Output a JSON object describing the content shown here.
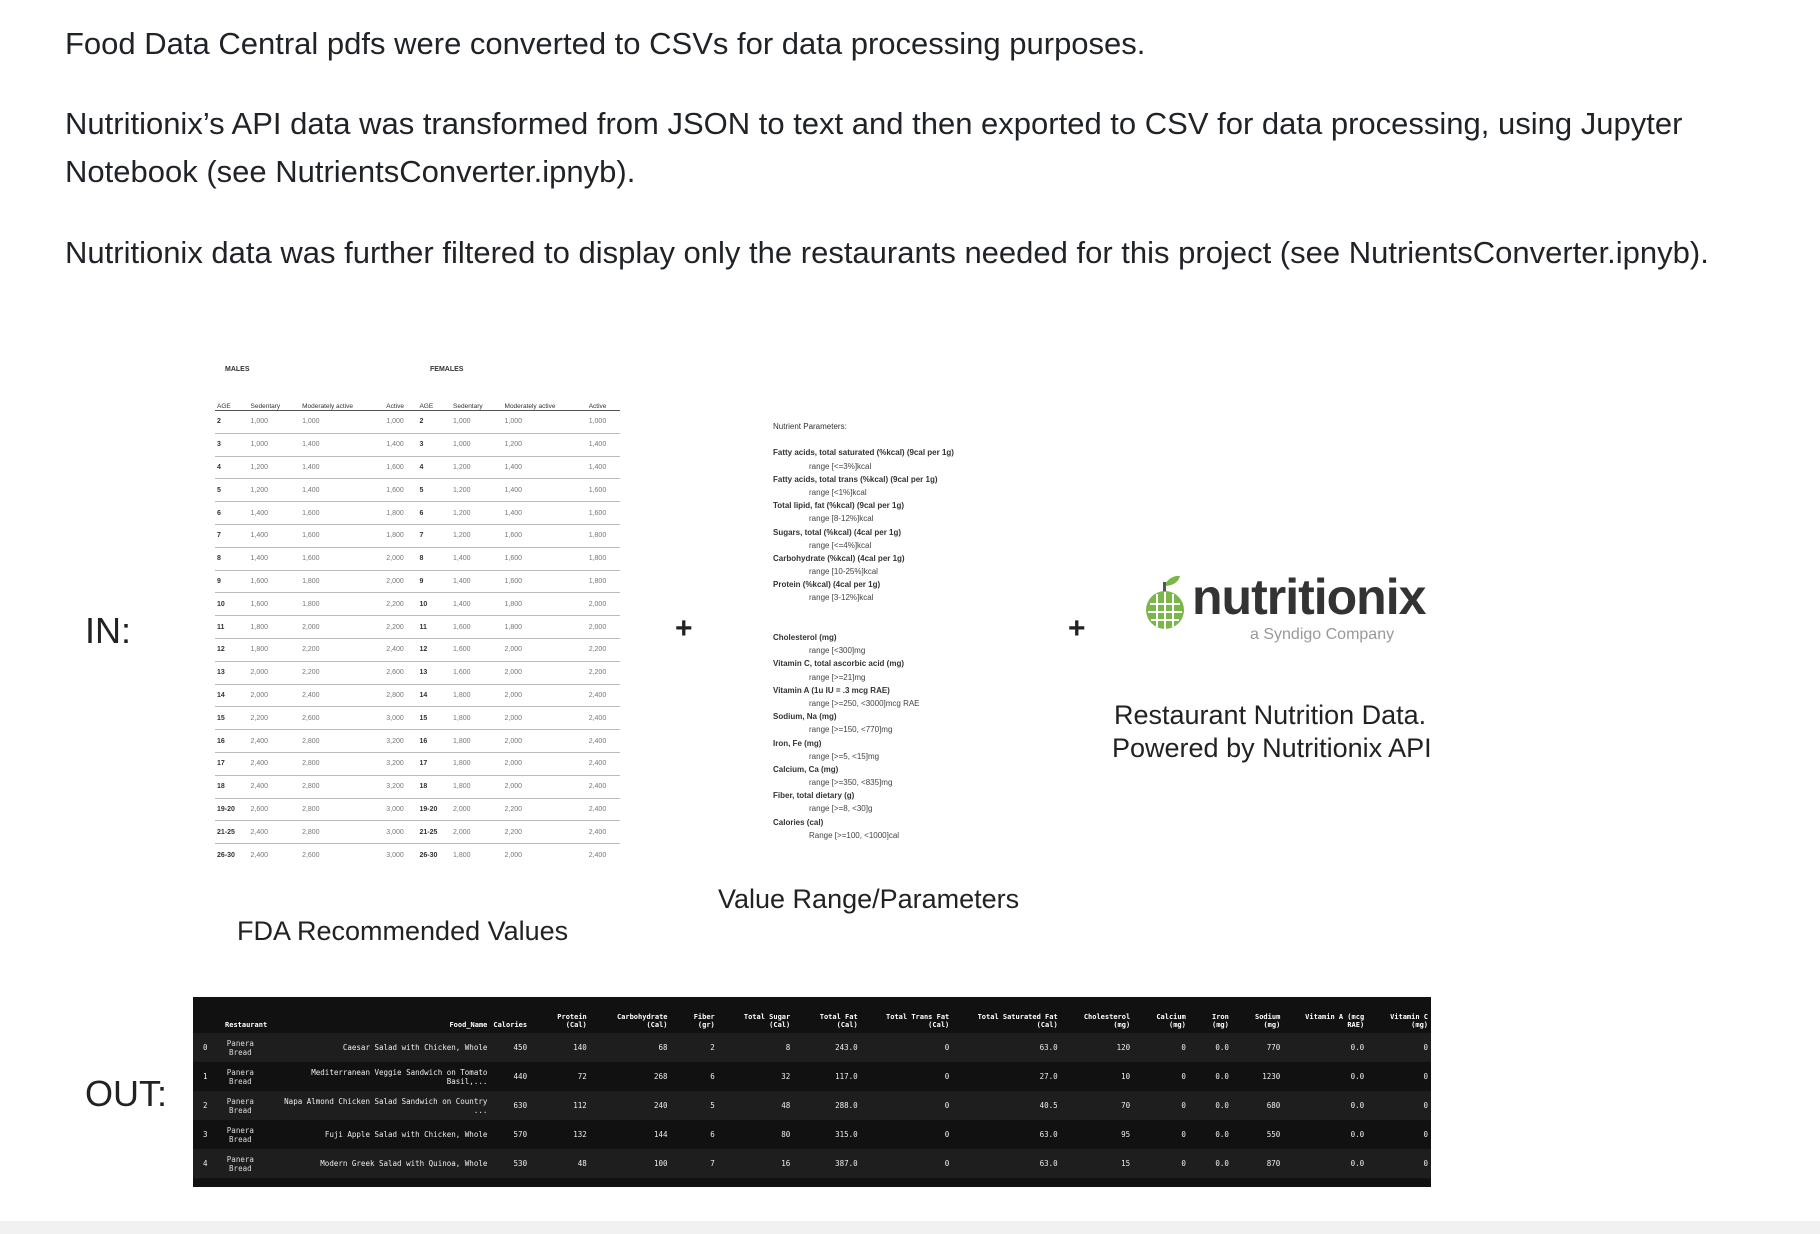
{
  "paragraphs": {
    "p1": "Food Data Central pdfs were converted to CSVs for data processing purposes.",
    "p2": "Nutritionix’s API data was transformed from JSON to text and then exported to CSV for data processing, using Jupyter Notebook (see NutrientsConverter.ipnyb).",
    "p3": "Nutritionix data was further filtered to display only the restaurants needed for this project (see NutrientsConverter.ipnyb)."
  },
  "figure": {
    "in_label": "IN:",
    "out_label": "OUT:",
    "plus1": "+",
    "plus2": "+",
    "fda_caption": "FDA Recommended Values",
    "params_caption": "Value Range/Parameters",
    "nutritionix_caption_line1": "Restaurant Nutrition Data.",
    "nutritionix_caption_line2": "Powered by Nutritionix API",
    "logo_word": "nutritionix",
    "logo_sub": "a Syndigo Company"
  },
  "fda_table": {
    "males_label": "MALES",
    "females_label": "FEMALES",
    "headers": [
      "AGE",
      "Sedentary",
      "Moderately active",
      "Active",
      "AGE",
      "Sedentary",
      "Moderately active",
      "Active"
    ],
    "rows": [
      [
        "2",
        "1,000",
        "1,000",
        "1,000",
        "2",
        "1,000",
        "1,000",
        "1,000"
      ],
      [
        "3",
        "1,000",
        "1,400",
        "1,400",
        "3",
        "1,000",
        "1,200",
        "1,400"
      ],
      [
        "4",
        "1,200",
        "1,400",
        "1,600",
        "4",
        "1,200",
        "1,400",
        "1,400"
      ],
      [
        "5",
        "1,200",
        "1,400",
        "1,600",
        "5",
        "1,200",
        "1,400",
        "1,600"
      ],
      [
        "6",
        "1,400",
        "1,600",
        "1,800",
        "6",
        "1,200",
        "1,400",
        "1,600"
      ],
      [
        "7",
        "1,400",
        "1,600",
        "1,800",
        "7",
        "1,200",
        "1,600",
        "1,800"
      ],
      [
        "8",
        "1,400",
        "1,600",
        "2,000",
        "8",
        "1,400",
        "1,600",
        "1,800"
      ],
      [
        "9",
        "1,600",
        "1,800",
        "2,000",
        "9",
        "1,400",
        "1,600",
        "1,800"
      ],
      [
        "10",
        "1,600",
        "1,800",
        "2,200",
        "10",
        "1,400",
        "1,800",
        "2,000"
      ],
      [
        "11",
        "1,800",
        "2,000",
        "2,200",
        "11",
        "1,600",
        "1,800",
        "2,000"
      ],
      [
        "12",
        "1,800",
        "2,200",
        "2,400",
        "12",
        "1,600",
        "2,000",
        "2,200"
      ],
      [
        "13",
        "2,000",
        "2,200",
        "2,600",
        "13",
        "1,600",
        "2,000",
        "2,200"
      ],
      [
        "14",
        "2,000",
        "2,400",
        "2,800",
        "14",
        "1,800",
        "2,000",
        "2,400"
      ],
      [
        "15",
        "2,200",
        "2,600",
        "3,000",
        "15",
        "1,800",
        "2,000",
        "2,400"
      ],
      [
        "16",
        "2,400",
        "2,800",
        "3,200",
        "16",
        "1,800",
        "2,000",
        "2,400"
      ],
      [
        "17",
        "2,400",
        "2,800",
        "3,200",
        "17",
        "1,800",
        "2,000",
        "2,400"
      ],
      [
        "18",
        "2,400",
        "2,800",
        "3,200",
        "18",
        "1,800",
        "2,000",
        "2,400"
      ],
      [
        "19-20",
        "2,600",
        "2,800",
        "3,000",
        "19-20",
        "2,000",
        "2,200",
        "2,400"
      ],
      [
        "21-25",
        "2,400",
        "2,800",
        "3,000",
        "21-25",
        "2,000",
        "2,200",
        "2,400"
      ],
      [
        "26-30",
        "2,400",
        "2,600",
        "3,000",
        "26-30",
        "1,800",
        "2,000",
        "2,400"
      ]
    ]
  },
  "params": [
    {
      "t": "Nutrient Parameters:",
      "k": "h"
    },
    {
      "t": "",
      "k": "s"
    },
    {
      "t": "Fatty acids, total saturated (%kcal) (9cal per 1g)",
      "k": "b"
    },
    {
      "t": "range [<=3%]kcal",
      "k": "r"
    },
    {
      "t": "Fatty acids, total trans (%kcal) (9cal per 1g)",
      "k": "b"
    },
    {
      "t": "range [<1%]kcal",
      "k": "r"
    },
    {
      "t": "Total lipid, fat (%kcal) (9cal per 1g)",
      "k": "b"
    },
    {
      "t": "range [8-12%]kcal",
      "k": "r"
    },
    {
      "t": "Sugars, total (%kcal) (4cal per 1g)",
      "k": "b"
    },
    {
      "t": "range [<=4%]kcal",
      "k": "r"
    },
    {
      "t": "Carbohydrate (%kcal) (4cal per 1g)",
      "k": "b"
    },
    {
      "t": "range [10-25%]kcal",
      "k": "r"
    },
    {
      "t": "Protein (%kcal) (4cal per 1g)",
      "k": "b"
    },
    {
      "t": "range [3-12%]kcal",
      "k": "r"
    },
    {
      "t": "",
      "k": "s"
    },
    {
      "t": "",
      "k": "s"
    },
    {
      "t": "Cholesterol (mg)",
      "k": "b"
    },
    {
      "t": "range [<300]mg",
      "k": "r"
    },
    {
      "t": "Vitamin C, total ascorbic acid (mg)",
      "k": "b"
    },
    {
      "t": "range [>=21]mg",
      "k": "r"
    },
    {
      "t": "Vitamin A (1u IU = .3 mcg RAE)",
      "k": "b"
    },
    {
      "t": "range [>=250, <3000]mcg RAE",
      "k": "r"
    },
    {
      "t": "Sodium, Na (mg)",
      "k": "b"
    },
    {
      "t": "range [>=150, <770]mg",
      "k": "r"
    },
    {
      "t": "Iron, Fe (mg)",
      "k": "b"
    },
    {
      "t": "range [>=5, <15]mg",
      "k": "r"
    },
    {
      "t": "Calcium, Ca (mg)",
      "k": "b"
    },
    {
      "t": "range [>=350, <835]mg",
      "k": "r"
    },
    {
      "t": "Fiber, total dietary (g)",
      "k": "b"
    },
    {
      "t": "range [>=8, <30]g",
      "k": "r"
    },
    {
      "t": "Calories (cal)",
      "k": "b"
    },
    {
      "t": "Range [>=100, <1000]cal",
      "k": "r"
    }
  ],
  "out_table": {
    "headers": [
      "",
      "Restaurant",
      "Food_Name",
      "Calories",
      "Protein (Cal)",
      "Carbohydrate (Cal)",
      "Fiber (gr)",
      "Total Sugar (Cal)",
      "Total Fat (Cal)",
      "Total Trans Fat (Cal)",
      "Total Saturated Fat (Cal)",
      "Cholesterol (mg)",
      "Calcium (mg)",
      "Iron (mg)",
      "Sodium (mg)",
      "Vitamin A (mcg RAE)",
      "Vitamin C (mg)"
    ],
    "rows": [
      [
        "0",
        "Panera Bread",
        "Caesar Salad with Chicken, Whole",
        "450",
        "140",
        "68",
        "2",
        "8",
        "243.0",
        "0",
        "63.0",
        "120",
        "0",
        "0.0",
        "770",
        "0.0",
        "0"
      ],
      [
        "1",
        "Panera Bread",
        "Mediterranean Veggie Sandwich on Tomato Basil,...",
        "440",
        "72",
        "268",
        "6",
        "32",
        "117.0",
        "0",
        "27.0",
        "10",
        "0",
        "0.0",
        "1230",
        "0.0",
        "0"
      ],
      [
        "2",
        "Panera Bread",
        "Napa Almond Chicken Salad Sandwich on Country ...",
        "630",
        "112",
        "240",
        "5",
        "48",
        "288.0",
        "0",
        "40.5",
        "70",
        "0",
        "0.0",
        "680",
        "0.0",
        "0"
      ],
      [
        "3",
        "Panera Bread",
        "Fuji Apple Salad with Chicken, Whole",
        "570",
        "132",
        "144",
        "6",
        "80",
        "315.0",
        "0",
        "63.0",
        "95",
        "0",
        "0.0",
        "550",
        "0.0",
        "0"
      ],
      [
        "4",
        "Panera Bread",
        "Modern Greek Salad with Quinoa, Whole",
        "530",
        "48",
        "100",
        "7",
        "16",
        "387.0",
        "0",
        "63.0",
        "15",
        "0",
        "0.0",
        "870",
        "0.0",
        "0"
      ]
    ]
  }
}
